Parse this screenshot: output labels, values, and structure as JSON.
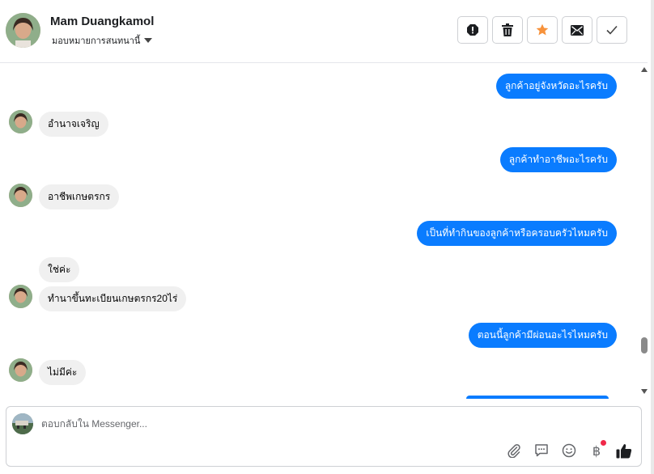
{
  "header": {
    "name": "Mam Duangkamol",
    "assign_label": "มอบหมายการสนทนานี้",
    "actions": [
      {
        "icon": "alert-icon"
      },
      {
        "icon": "trash-icon"
      },
      {
        "icon": "star-icon",
        "color": "#f7923b"
      },
      {
        "icon": "envelope-icon"
      },
      {
        "icon": "check-icon"
      }
    ]
  },
  "messages": [
    {
      "side": "out",
      "text": "ลูกค้าอยู่จังหวัดอะไรครับ"
    },
    {
      "side": "in",
      "text": "อำนาจเจริญ"
    },
    {
      "side": "out",
      "text": "ลูกค้าทำอาชีพอะไรครับ"
    },
    {
      "side": "in",
      "text": "อาชีพเกษตรกร"
    },
    {
      "side": "out",
      "text": "เป็นที่ทำกินของลูกค้าหรือครอบครัวไหมครับ"
    },
    {
      "side": "in",
      "text": "ใช่ค่ะ"
    },
    {
      "side": "in",
      "text": "ทำนาขึ้นทะเบียนเกษตรกร20ไร่"
    },
    {
      "side": "out",
      "text": "ตอนนี้ลูกค้ามีผ่อนอะไรไหมครับ"
    },
    {
      "side": "in",
      "text": "ไม่มีค่ะ"
    }
  ],
  "composer": {
    "placeholder": "ตอบกลับใน Messenger...",
    "value": "",
    "tools": [
      "paperclip-icon",
      "saved-reply-icon",
      "emoji-icon",
      "baht-icon",
      "like-icon"
    ],
    "baht_symbol": "฿"
  },
  "colors": {
    "outgoing": "#0a7cff",
    "incoming": "#f0f0f0",
    "star": "#f7923b",
    "like": "#1c1e21",
    "notification_dot": "#f02849"
  }
}
